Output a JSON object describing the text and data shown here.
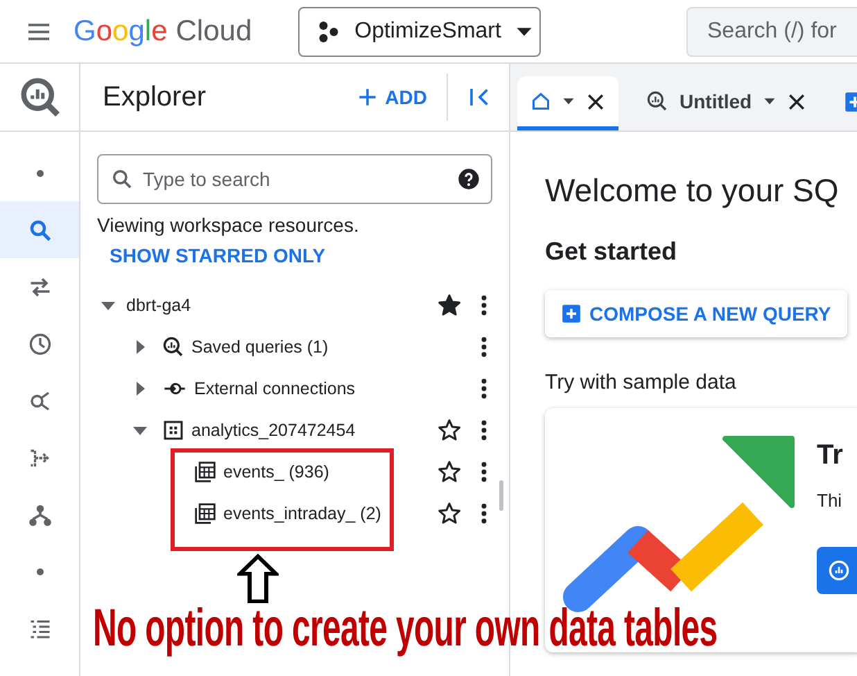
{
  "topbar": {
    "logo_word": "Google",
    "logo_product": "Cloud",
    "project": "OptimizeSmart",
    "search": {
      "placeholder": "Search (/) for"
    }
  },
  "rail": [
    {
      "kind": "dot",
      "selected": false
    },
    {
      "kind": "search",
      "selected": true
    },
    {
      "kind": "transfer",
      "selected": false
    },
    {
      "kind": "history",
      "selected": false
    },
    {
      "kind": "nodes",
      "selected": false
    },
    {
      "kind": "pipeline",
      "selected": false
    },
    {
      "kind": "hierarchy",
      "selected": false
    },
    {
      "kind": "dot",
      "selected": false
    },
    {
      "kind": "list",
      "selected": false
    }
  ],
  "explorer": {
    "title": "Explorer",
    "add_label": "ADD",
    "search": {
      "placeholder": "Type to search"
    },
    "info": "Viewing workspace resources.",
    "starred_link": "SHOW STARRED ONLY",
    "tree": [
      {
        "label": "dbrt-ga4",
        "expanded": true,
        "starred": true,
        "children": [
          {
            "label": "Saved queries (1)",
            "kind": "saved",
            "expanded": false
          },
          {
            "label": "External connections",
            "kind": "connection",
            "expanded": false
          },
          {
            "label": "analytics_207472454",
            "kind": "dataset",
            "expanded": true,
            "starred": false,
            "children": [
              {
                "label": "events_ (936)",
                "kind": "table",
                "starred": false
              },
              {
                "label": "events_intraday_ (2)",
                "kind": "table",
                "starred": false
              }
            ]
          }
        ]
      }
    ]
  },
  "tabs": [
    {
      "kind": "home",
      "selected": true
    },
    {
      "kind": "query",
      "label": "Untitled",
      "selected": false
    }
  ],
  "welcome": {
    "title": "Welcome to your SQ",
    "get_started": "Get started",
    "compose_label": "COMPOSE A NEW QUERY",
    "sample_heading": "Try with sample data",
    "card_title": "Tr",
    "card_text": "Thi"
  },
  "annotation": {
    "text": "No option to create your own data tables"
  }
}
